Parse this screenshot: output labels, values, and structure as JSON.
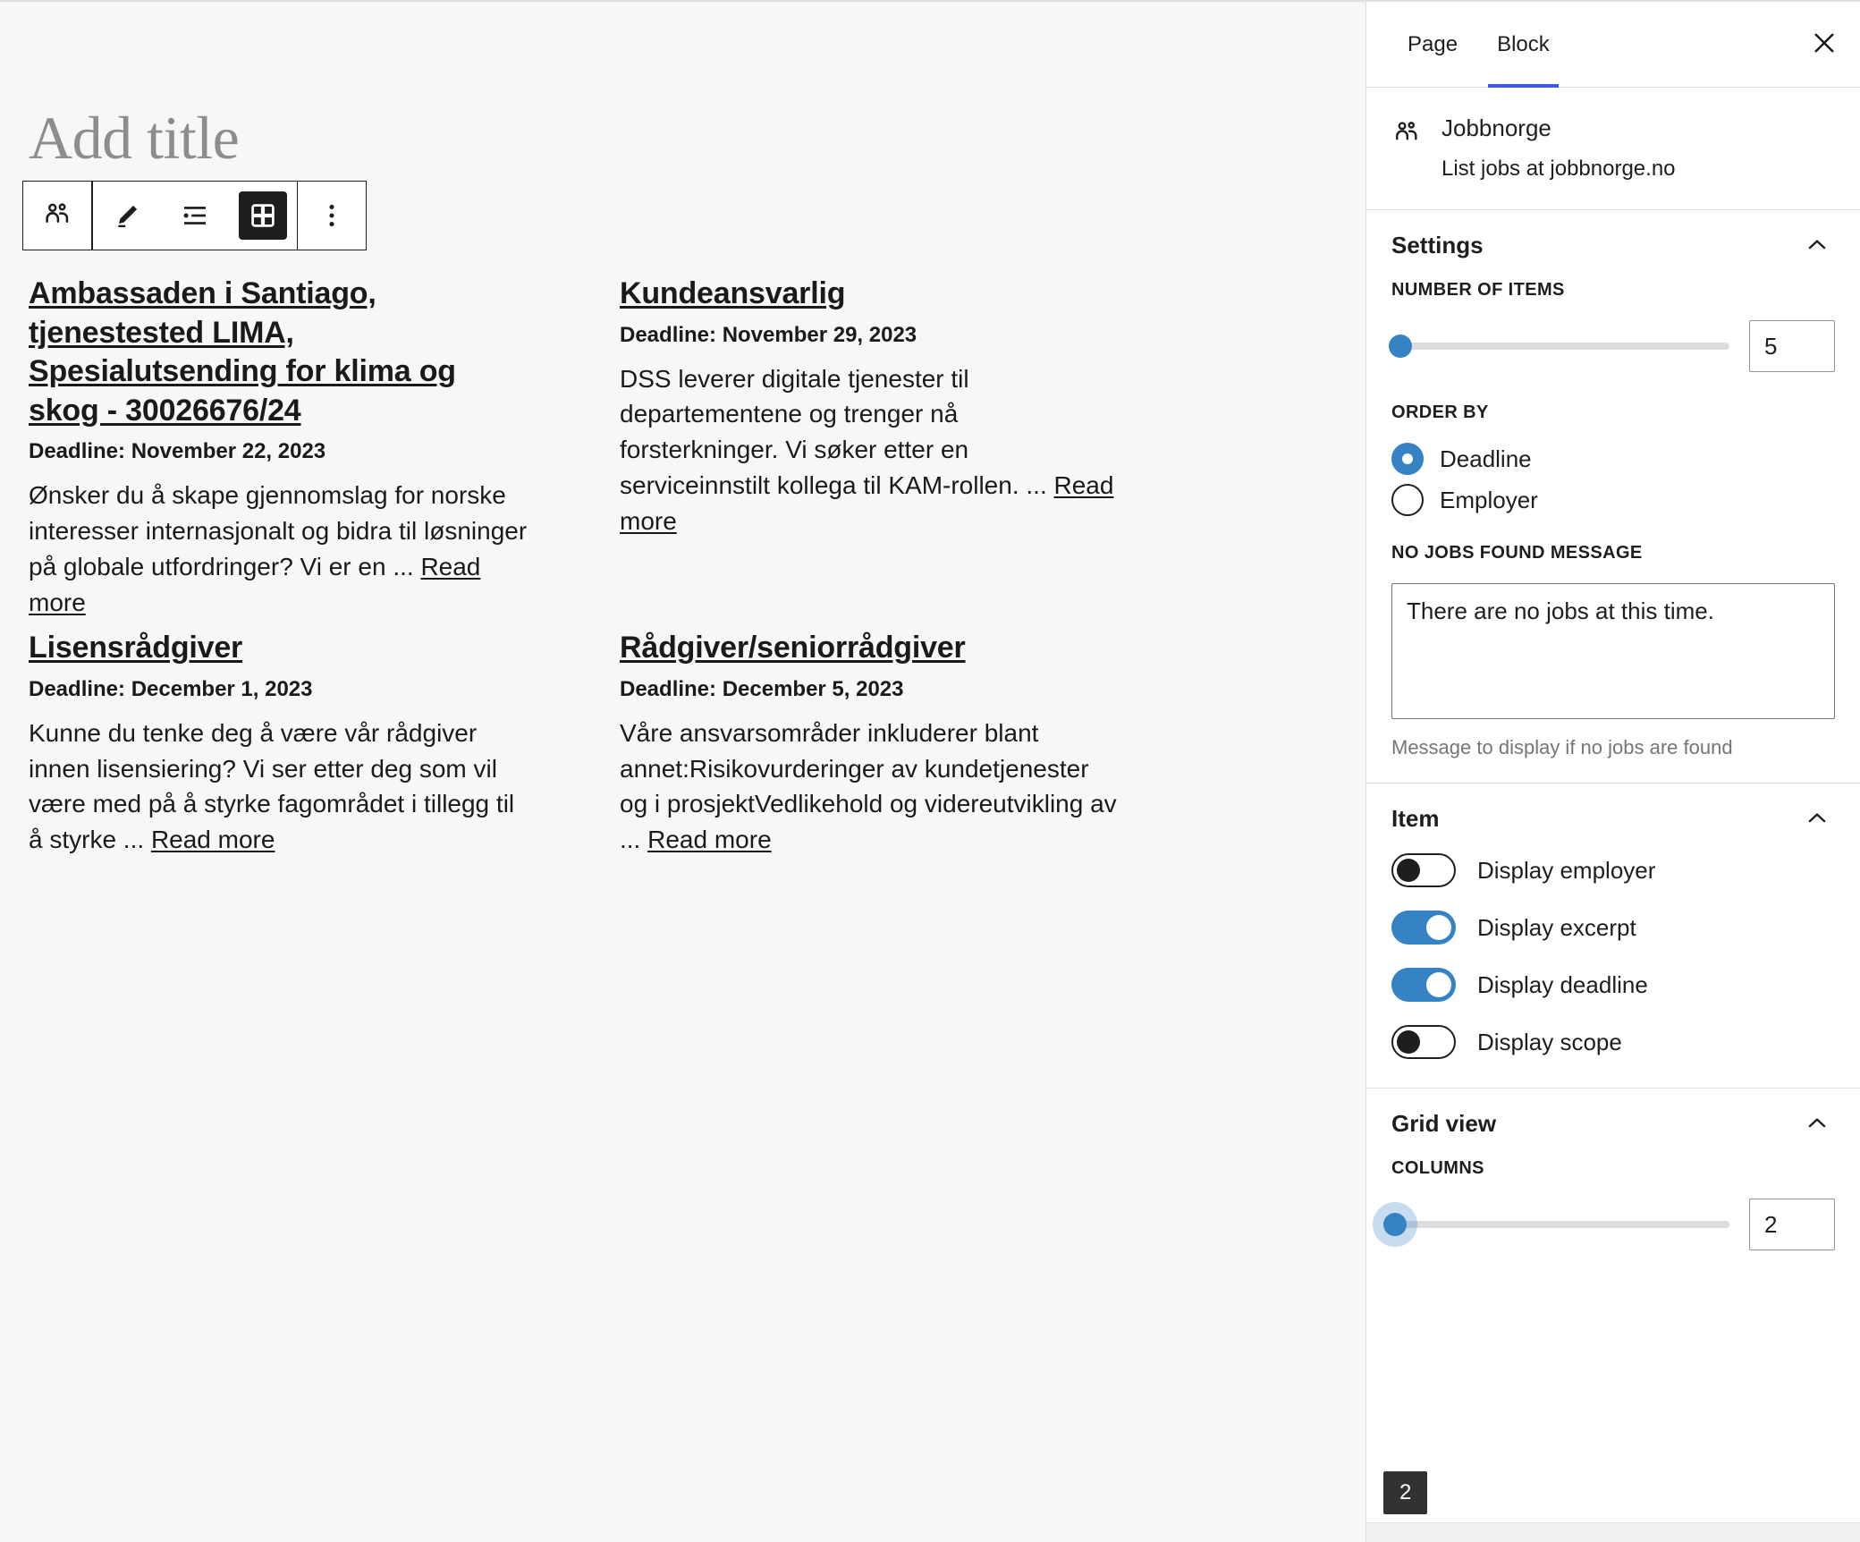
{
  "editor": {
    "title_placeholder": "Add title",
    "toolbar": {
      "buttons": [
        {
          "name": "block-type-jobbnorge",
          "icon": "people-icon",
          "active": false
        },
        {
          "name": "edit-pencil",
          "icon": "pencil-icon",
          "active": false
        },
        {
          "name": "list-view",
          "icon": "list-view-icon",
          "active": false
        },
        {
          "name": "grid-view",
          "icon": "grid-view-icon",
          "active": true
        },
        {
          "name": "more-options",
          "icon": "ellipsis-vertical-icon",
          "active": false
        }
      ]
    },
    "jobs": [
      {
        "title": "Ambassaden i Santiago, tjenestested LIMA, Spesialutsending for klima og skog - 30026676/24",
        "title_link_segments": [
          "Ambassaden i Santiago",
          ", ",
          "tjenestested LIMA",
          ", ",
          "Spesialutsending for klima og skog - 30026676/24"
        ],
        "deadline": "Deadline: November 22, 2023",
        "excerpt": "Ønsker du å skape gjennomslag for norske interesser internasjonalt og bidra til løsninger på globale utfordringer? Vi er en ...",
        "read_more": "Read more"
      },
      {
        "title": "Kundeansvarlig",
        "deadline": "Deadline: November 29, 2023",
        "excerpt": "DSS leverer digitale tjenester til departementene og trenger nå forsterkninger. Vi søker etter en serviceinnstilt kollega til KAM-rollen. ...",
        "read_more": "Read more"
      },
      {
        "title": "Lisensrådgiver",
        "deadline": "Deadline: December 1, 2023",
        "excerpt": "Kunne du tenke deg å være vår rådgiver innen lisensiering? Vi ser etter deg som vil være med på å styrke fagområdet i tillegg til å styrke ...",
        "read_more": "Read more"
      },
      {
        "title": "Rådgiver/seniorrådgiver",
        "deadline": "Deadline: December 5, 2023",
        "excerpt": "Våre ansvarsområder inkluderer blant annet:Risikovurderinger av kundetjenester og i prosjektVedlikehold og videreutvikling av ...",
        "read_more": "Read more"
      }
    ]
  },
  "sidebar": {
    "tabs": [
      {
        "label": "Page",
        "active": false
      },
      {
        "label": "Block",
        "active": true
      }
    ],
    "close_label": "close-icon",
    "block_card": {
      "icon": "people-icon",
      "title": "Jobbnorge",
      "description": "List jobs at jobbnorge.no"
    },
    "settings_panel": {
      "title": "Settings",
      "number_of_items_label": "NUMBER OF ITEMS",
      "number_of_items_value": "5",
      "order_by_label": "ORDER BY",
      "order_by_options": [
        {
          "label": "Deadline",
          "checked": true
        },
        {
          "label": "Employer",
          "checked": false
        }
      ],
      "no_jobs_label": "NO JOBS FOUND MESSAGE",
      "no_jobs_value": "There are no jobs at this time.",
      "no_jobs_help": "Message to display if no jobs are found"
    },
    "item_panel": {
      "title": "Item",
      "toggles": [
        {
          "label": "Display employer",
          "on": false
        },
        {
          "label": "Display excerpt",
          "on": true
        },
        {
          "label": "Display deadline",
          "on": true
        },
        {
          "label": "Display scope",
          "on": false
        }
      ]
    },
    "grid_panel": {
      "title": "Grid view",
      "columns_label": "COLUMNS",
      "columns_value": "2",
      "columns_tooltip": "2"
    }
  },
  "colors": {
    "accent_blue": "#3582c4",
    "tab_underline": "#3858e9",
    "canvas_bg": "#f7f7f7",
    "text": "#1e1e1e",
    "muted": "#757575",
    "tooltip_bg": "#323232"
  }
}
